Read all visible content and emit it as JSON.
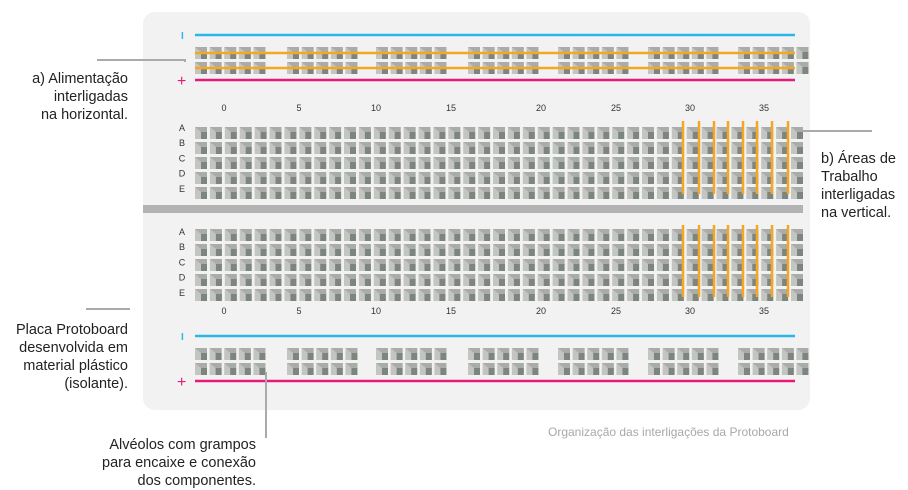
{
  "labels": {
    "a": [
      "a) Alimentação",
      "interligadas",
      "na horizontal."
    ],
    "b": [
      "b) Áreas de",
      "Trabalho",
      "interligadas",
      "na vertical."
    ],
    "placa": [
      "Placa Protoboard",
      "desenvolvida em",
      "material plástico",
      "(isolante)."
    ],
    "alveolos": [
      "Alvéolos com grampos",
      "para encaixe e conexão",
      "dos componentes."
    ]
  },
  "caption": "Organização das interligações da Protoboard",
  "rails": {
    "negative_symbol": "I",
    "positive_symbol": "+"
  },
  "column_numbers": [
    "0",
    "5",
    "10",
    "15",
    "20",
    "25",
    "30",
    "35"
  ],
  "row_letters": [
    "A",
    "B",
    "C",
    "D",
    "E"
  ],
  "colors": {
    "board": "#f2f2f2",
    "negative_rail": "#29b6e8",
    "positive_rail": "#e8197a",
    "interconnect": "#f5a623",
    "hole_light": "#c3c5c3",
    "hole_dark": "#7c857e",
    "divider": "#b3b3b3",
    "leader": "#aaaaaa"
  }
}
